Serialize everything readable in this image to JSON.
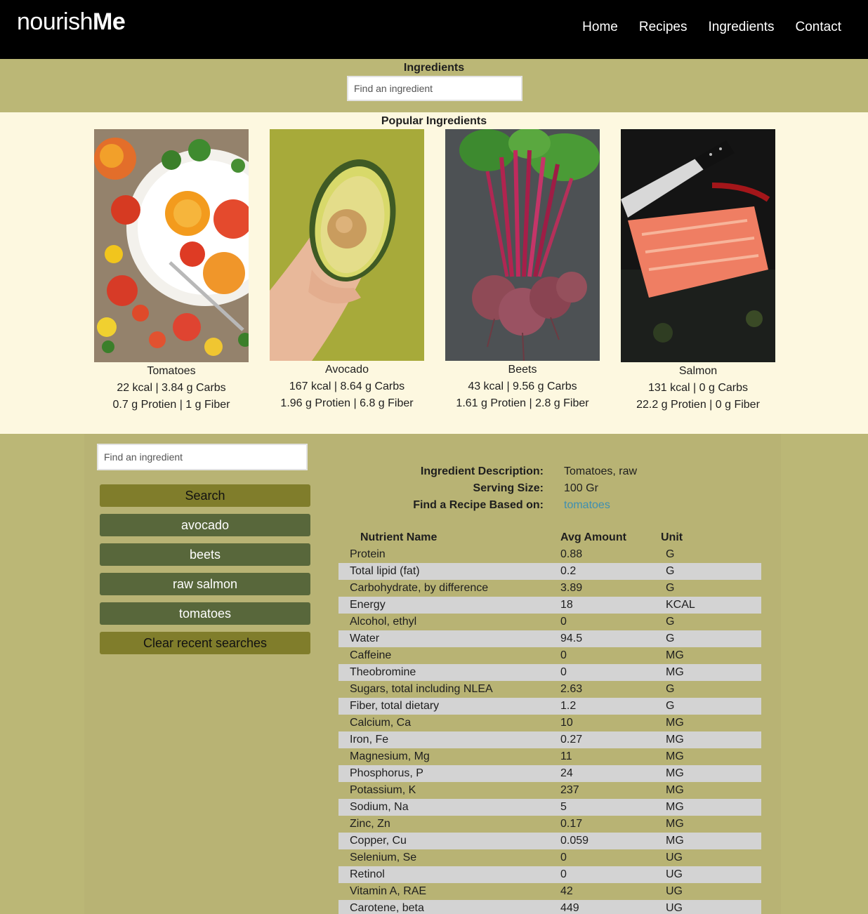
{
  "header": {
    "brand_light": "nourish",
    "brand_bold": "Me",
    "nav": [
      "Home",
      "Recipes",
      "Ingredients",
      "Contact"
    ]
  },
  "search_band": {
    "title": "Ingredients",
    "placeholder": "Find an ingredient"
  },
  "popular": {
    "title": "Popular Ingredients",
    "items": [
      {
        "name": "Tomatoes",
        "line1": "22 kcal | 3.84 g Carbs",
        "line2": "0.7 g Protien | 1 g Fiber",
        "photo": "tomatoes-photo"
      },
      {
        "name": "Avocado",
        "line1": "167 kcal | 8.64 g Carbs",
        "line2": "1.96 g Protien | 6.8 g Fiber",
        "photo": "avocado-photo"
      },
      {
        "name": "Beets",
        "line1": "43 kcal | 9.56 g Carbs",
        "line2": "1.61 g Protien | 2.8 g Fiber",
        "photo": "beets-photo"
      },
      {
        "name": "Salmon",
        "line1": "131 kcal | 0 g Carbs",
        "line2": "22.2 g Protien | 0 g Fiber",
        "photo": "salmon-photo"
      }
    ]
  },
  "sidebar": {
    "placeholder": "Find an ingredient",
    "search_label": "Search",
    "recent": [
      "avocado",
      "beets",
      "raw salmon",
      "tomatoes"
    ],
    "clear_label": "Clear recent searches"
  },
  "details": {
    "description_label": "Ingredient Description:",
    "description_value": "Tomatoes, raw",
    "serving_label": "Serving Size:",
    "serving_value": "100 Gr",
    "recipe_label": "Find a Recipe Based on:",
    "recipe_link": "tomatoes"
  },
  "nutrients": {
    "headers": [
      "Nutrient Name",
      "Avg Amount",
      "Unit"
    ],
    "rows": [
      [
        "Protein",
        "0.88",
        "G"
      ],
      [
        "Total lipid (fat)",
        "0.2",
        "G"
      ],
      [
        "Carbohydrate, by difference",
        "3.89",
        "G"
      ],
      [
        "Energy",
        "18",
        "KCAL"
      ],
      [
        "Alcohol, ethyl",
        "0",
        "G"
      ],
      [
        "Water",
        "94.5",
        "G"
      ],
      [
        "Caffeine",
        "0",
        "MG"
      ],
      [
        "Theobromine",
        "0",
        "MG"
      ],
      [
        "Sugars, total including NLEA",
        "2.63",
        "G"
      ],
      [
        "Fiber, total dietary",
        "1.2",
        "G"
      ],
      [
        "Calcium, Ca",
        "10",
        "MG"
      ],
      [
        "Iron, Fe",
        "0.27",
        "MG"
      ],
      [
        "Magnesium, Mg",
        "11",
        "MG"
      ],
      [
        "Phosphorus, P",
        "24",
        "MG"
      ],
      [
        "Potassium, K",
        "237",
        "MG"
      ],
      [
        "Sodium, Na",
        "5",
        "MG"
      ],
      [
        "Zinc, Zn",
        "0.17",
        "MG"
      ],
      [
        "Copper, Cu",
        "0.059",
        "MG"
      ],
      [
        "Selenium, Se",
        "0",
        "UG"
      ],
      [
        "Retinol",
        "0",
        "UG"
      ],
      [
        "Vitamin A, RAE",
        "42",
        "UG"
      ],
      [
        "Carotene, beta",
        "449",
        "UG"
      ]
    ]
  },
  "colors": {
    "header_bg": "#000000",
    "band_bg": "#bbb776",
    "popular_bg": "#fdf8e0",
    "panel_bg": "#b8b374",
    "button_olive": "#807d2b",
    "button_green": "#58673b",
    "link": "#3f8fb0",
    "row_alt": "#d3d3d3"
  }
}
